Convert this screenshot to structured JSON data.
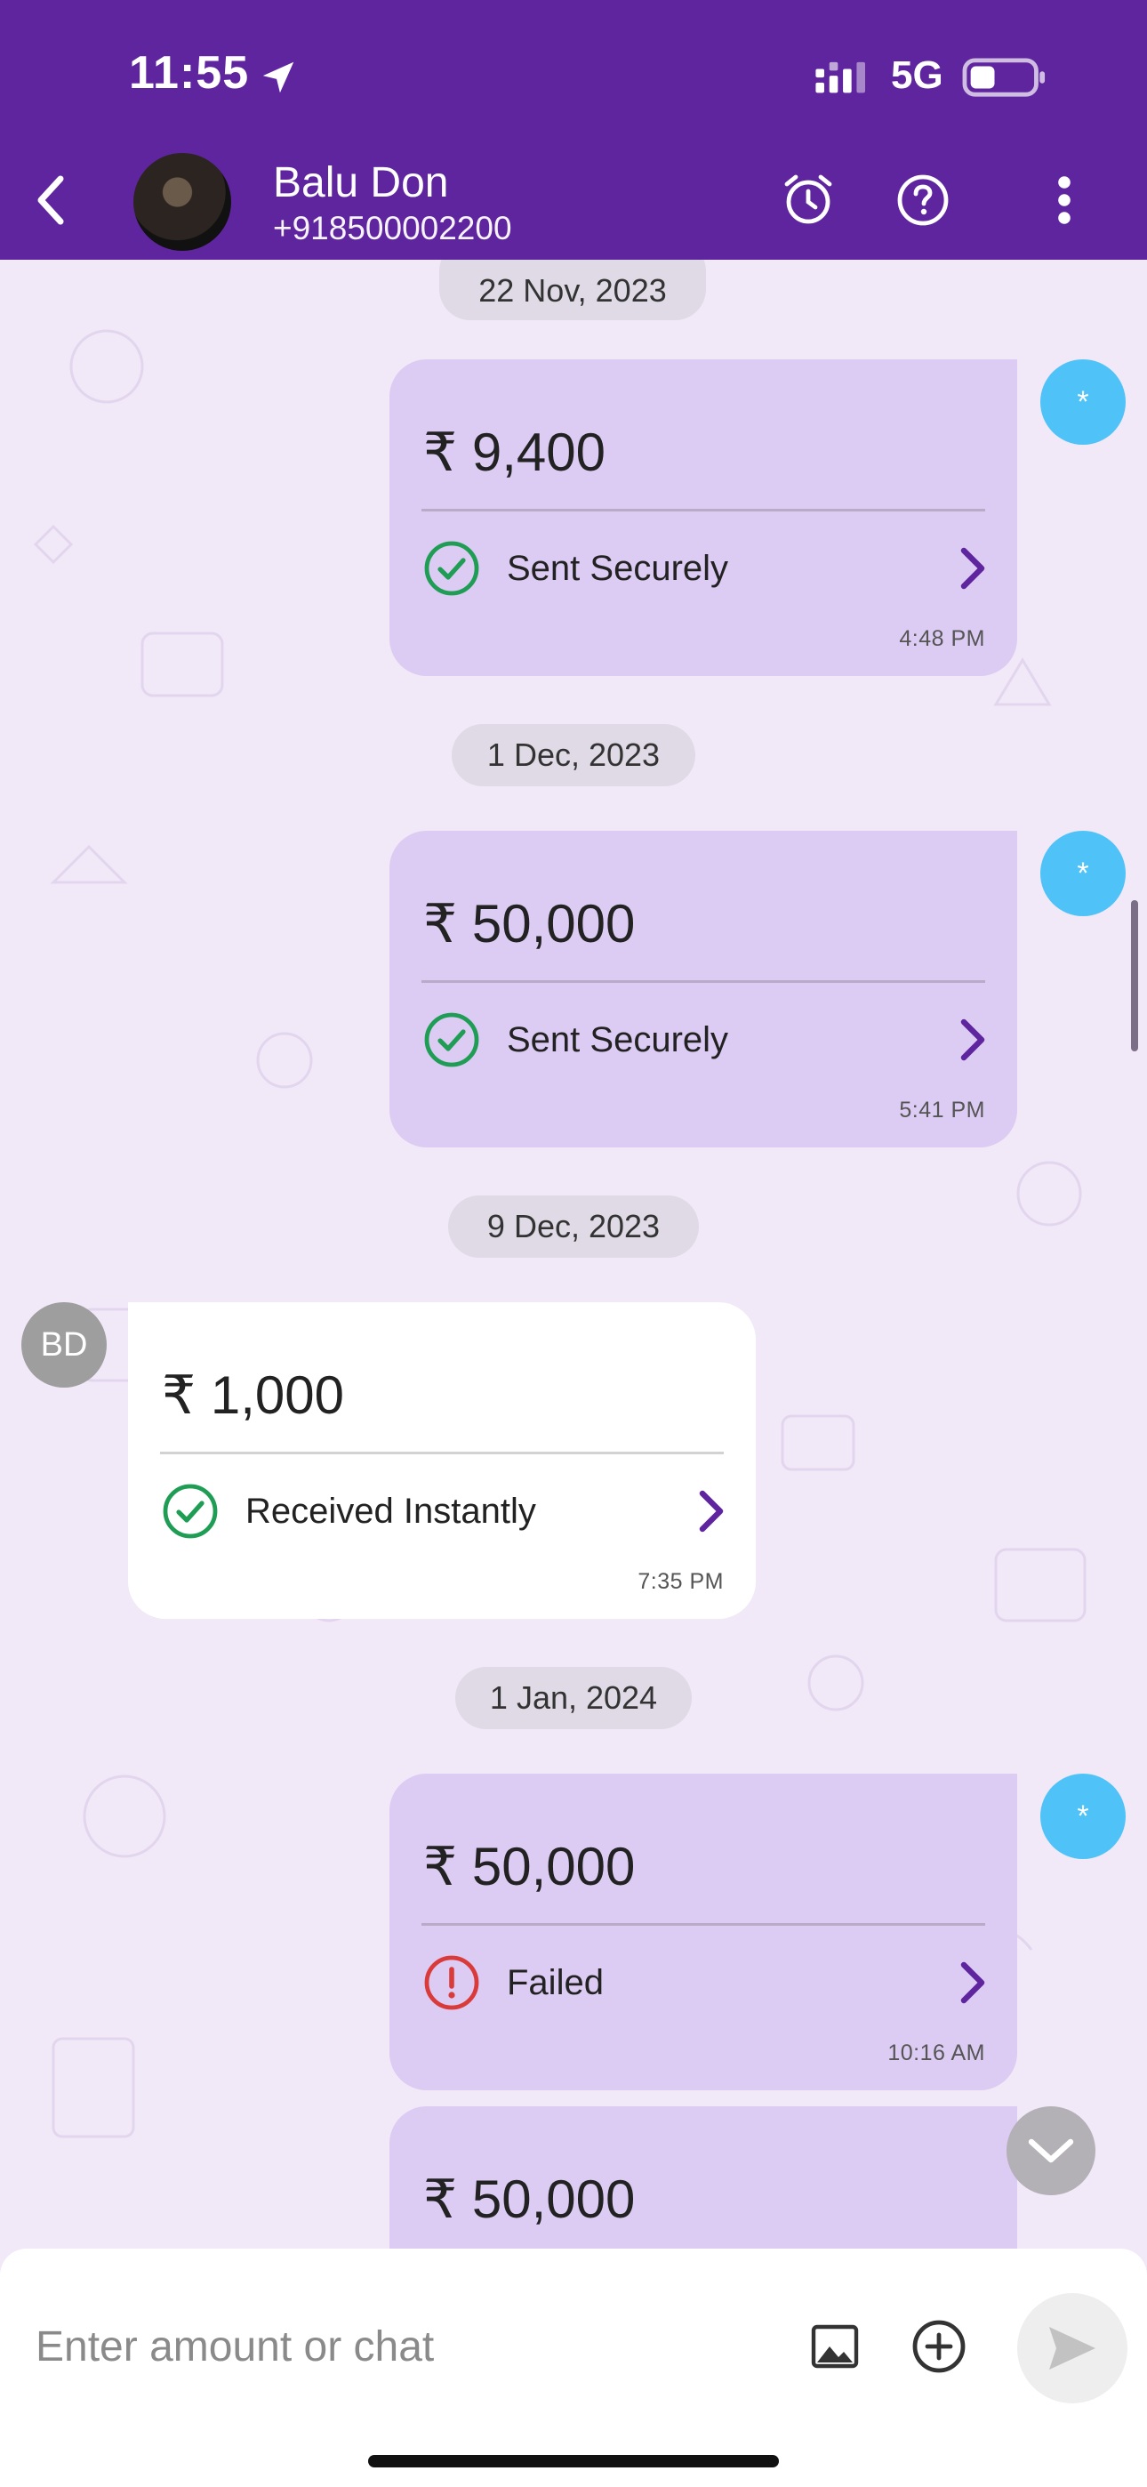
{
  "status_bar": {
    "time": "11:55",
    "network": "5G"
  },
  "header": {
    "contact_name": "Balu Don",
    "contact_phone": "+918500002200",
    "icons": [
      "back-arrow-icon",
      "alarm-icon",
      "help-icon",
      "more-vert-icon"
    ]
  },
  "chat": {
    "partial_date_top": "22 Nov, 2023",
    "me_badge": "*",
    "sender_initials": "BD",
    "dates": [
      "22 Nov, 2023",
      "1 Dec, 2023",
      "9 Dec, 2023",
      "1 Jan, 2024"
    ],
    "messages": [
      {
        "direction": "sent",
        "amount": "₹ 9,400",
        "status": "Sent Securely",
        "status_type": "success",
        "time": "4:48 PM"
      },
      {
        "direction": "sent",
        "amount": "₹ 50,000",
        "status": "Sent Securely",
        "status_type": "success",
        "time": "5:41 PM"
      },
      {
        "direction": "received",
        "amount": "₹ 1,000",
        "status": "Received Instantly",
        "status_type": "success",
        "time": "7:35 PM"
      },
      {
        "direction": "sent",
        "amount": "₹ 50,000",
        "status": "Failed",
        "status_type": "error",
        "time": "10:16 AM"
      },
      {
        "direction": "sent",
        "amount": "₹ 50,000"
      }
    ]
  },
  "input_bar": {
    "placeholder": "Enter amount or chat",
    "icons": [
      "image-icon",
      "add-circle-icon",
      "send-icon"
    ]
  },
  "colors": {
    "brand": "#5f259f",
    "sent_bubble": "#dccbf3",
    "received_bubble": "#ffffff",
    "success": "#1f9d55",
    "error": "#d93b3b",
    "me_badge": "#4fc3f7"
  }
}
